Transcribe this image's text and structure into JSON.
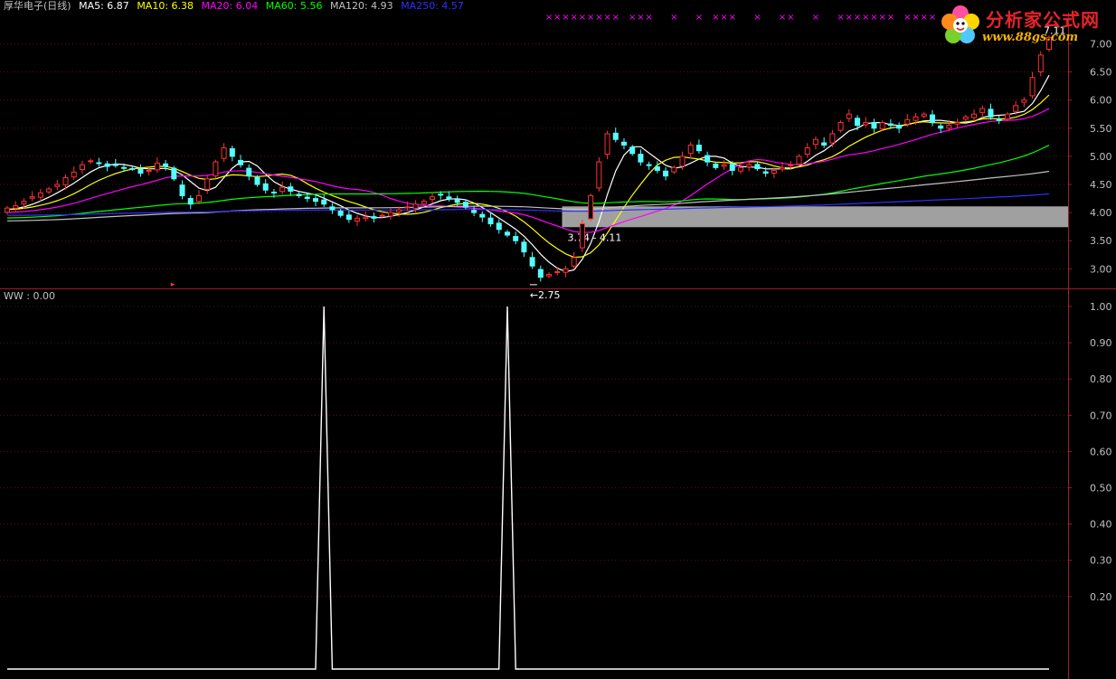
{
  "header": {
    "stock_name": "厚华电子(日线)",
    "ma": [
      {
        "label": "MA5: 6.87",
        "color": "#ffffff"
      },
      {
        "label": "MA10: 6.38",
        "color": "#ffff00"
      },
      {
        "label": "MA20: 6.04",
        "color": "#ff00ff"
      },
      {
        "label": "MA60: 5.56",
        "color": "#00ff00"
      },
      {
        "label": "MA120: 4.93",
        "color": "#c0c0c0"
      },
      {
        "label": "MA250: 4.57",
        "color": "#3030ff"
      }
    ]
  },
  "indicator": {
    "label": "WW : 0.00"
  },
  "logo": {
    "title": "分析家公式网",
    "url": "www.88gs.com"
  },
  "colors": {
    "up": "#ff3232",
    "down": "#54ffff",
    "grid": "#5a1010",
    "axis": "#a02020",
    "zone": "#a0a0a0",
    "signal": "#ff00ff"
  },
  "chart_data": [
    {
      "type": "candlestick",
      "ylim": [
        2.7,
        7.2
      ],
      "yticks": [
        3.0,
        3.5,
        4.0,
        4.5,
        5.0,
        5.5,
        6.0,
        6.5,
        7.0
      ],
      "ytick_labels": [
        "3.00",
        "3.50",
        "4.00",
        "4.50",
        "5.00",
        "5.50",
        "6.00",
        "6.50",
        "7.00"
      ],
      "close": [
        4.08,
        4.12,
        4.2,
        4.28,
        4.35,
        4.42,
        4.5,
        4.62,
        4.72,
        4.85,
        4.92,
        4.88,
        4.82,
        4.85,
        4.8,
        4.78,
        4.7,
        4.75,
        4.88,
        4.82,
        4.6,
        4.3,
        4.15,
        4.3,
        4.6,
        4.9,
        5.15,
        5.0,
        4.85,
        4.65,
        4.5,
        4.4,
        4.35,
        4.45,
        4.38,
        4.3,
        4.25,
        4.2,
        4.15,
        4.05,
        3.95,
        3.88,
        3.9,
        3.92,
        3.9,
        3.95,
        4.0,
        4.05,
        4.1,
        4.15,
        4.2,
        4.28,
        4.32,
        4.25,
        4.18,
        4.1,
        4.0,
        3.92,
        3.8,
        3.7,
        3.6,
        3.5,
        3.3,
        3.05,
        2.85,
        2.9,
        2.95,
        3.0,
        3.2,
        3.8,
        4.3,
        4.9,
        5.4,
        5.3,
        5.2,
        5.05,
        4.9,
        4.85,
        4.75,
        4.65,
        4.8,
        5.0,
        5.2,
        5.1,
        4.9,
        4.8,
        4.85,
        4.75,
        4.8,
        4.85,
        4.78,
        4.7,
        4.75,
        4.8,
        4.85,
        5.0,
        5.15,
        5.3,
        5.2,
        5.4,
        5.6,
        5.75,
        5.55,
        5.6,
        5.5,
        5.6,
        5.55,
        5.5,
        5.65,
        5.7,
        5.75,
        5.6,
        5.5,
        5.55,
        5.6,
        5.7,
        5.75,
        5.85,
        5.7,
        5.65,
        5.75,
        5.9,
        6.0,
        6.4,
        6.8,
        7.11
      ],
      "low_mark": {
        "label": "2.75",
        "value": 2.75,
        "index": 64
      },
      "high_mark": {
        "label": "7.11",
        "value": 7.11,
        "index": 125
      },
      "zone": {
        "label": "3.74 - 4.11",
        "low": 3.74,
        "high": 4.11,
        "start_index": 67
      },
      "signal_indices": [
        65,
        66,
        67,
        68,
        69,
        70,
        71,
        72,
        73,
        75,
        76,
        77,
        80,
        83,
        85,
        86,
        87,
        90,
        93,
        94,
        97,
        100,
        101,
        102,
        103,
        104,
        105,
        106,
        108,
        109,
        110,
        111
      ],
      "ma_series": [
        {
          "name": "MA5",
          "color": "#ffffff",
          "last": 6.87
        },
        {
          "name": "MA10",
          "color": "#ffff00",
          "last": 6.38
        },
        {
          "name": "MA20",
          "color": "#ff00ff",
          "last": 6.04
        },
        {
          "name": "MA60",
          "color": "#00ff00",
          "last": 5.56
        },
        {
          "name": "MA120",
          "color": "#c0c0c0",
          "last": 4.93
        },
        {
          "name": "MA250",
          "color": "#3030ff",
          "last": 4.57
        }
      ]
    },
    {
      "type": "line",
      "series_name": "WW",
      "ylim": [
        0.0,
        1.0
      ],
      "yticks": [
        0.2,
        0.3,
        0.4,
        0.5,
        0.6,
        0.7,
        0.8,
        0.9,
        1.0
      ],
      "ytick_labels": [
        "0.20",
        "0.30",
        "0.40",
        "0.50",
        "0.60",
        "0.70",
        "0.80",
        "0.90",
        "1.00"
      ],
      "points_count": 126,
      "spikes": [
        {
          "index": 38,
          "value": 1.0
        },
        {
          "index": 60,
          "value": 1.0
        }
      ]
    }
  ]
}
